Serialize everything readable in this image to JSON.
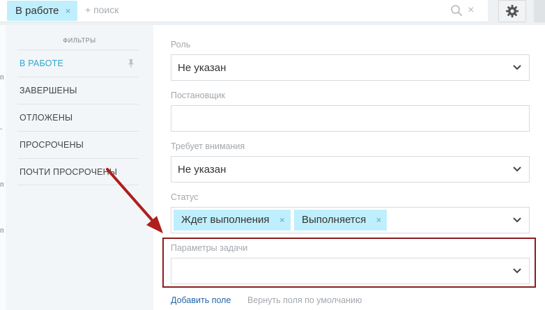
{
  "search": {
    "active_chip": "В работе",
    "chip_remove": "×",
    "placeholder": "+ поиск",
    "clear": "×"
  },
  "sidebar": {
    "title": "ФИЛЬТРЫ",
    "items": [
      {
        "label": "В РАБОТЕ",
        "active": true
      },
      {
        "label": "ЗАВЕРШЕНЫ",
        "active": false
      },
      {
        "label": "ОТЛОЖЕНЫ",
        "active": false
      },
      {
        "label": "ПРОСРОЧЕНЫ",
        "active": false
      },
      {
        "label": "ПОЧТИ ПРОСРОЧЕНЫ",
        "active": false
      }
    ]
  },
  "form": {
    "fields": [
      {
        "label": "Роль",
        "value": "Не указан"
      },
      {
        "label": "Постановщик",
        "value": ""
      },
      {
        "label": "Требует внимания",
        "value": "Не указан"
      },
      {
        "label": "Статус",
        "tags": [
          "Ждет выполнения",
          "Выполняется"
        ],
        "tag_remove": "×"
      },
      {
        "label": "Параметры задачи",
        "value": ""
      }
    ],
    "add_field": "Добавить поле",
    "reset_fields": "Вернуть поля по умолчанию"
  },
  "colors": {
    "accent": "#2fa6d3",
    "chip_bg": "#bfeffd",
    "highlight": "#8c1c1c",
    "arrow": "#b01e1e",
    "link": "#2467a8"
  },
  "icons": [
    "search-icon",
    "close-icon",
    "gear-icon",
    "pin-icon",
    "chevron-down-icon",
    "arrow-annotation"
  ]
}
